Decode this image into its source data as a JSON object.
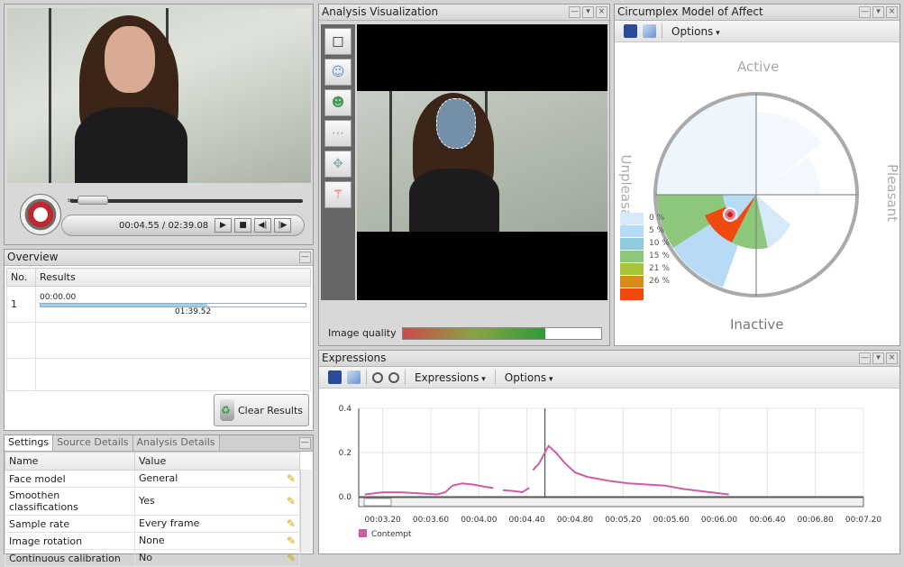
{
  "video": {
    "seek_equal": "=",
    "time_readout": "00:04.55 / 02:39.08",
    "progress_fraction": 0.03,
    "controls": [
      "▶",
      "■",
      "◀|",
      "|▶"
    ]
  },
  "overview": {
    "title": "Overview",
    "col_no": "No.",
    "col_results": "Results",
    "row_no": "1",
    "row_start": "00:00.00",
    "row_end": "01:39.52",
    "clear_label": "Clear Results"
  },
  "settings": {
    "tabs": [
      "Settings",
      "Source Details",
      "Analysis Details"
    ],
    "col_name": "Name",
    "col_value": "Value",
    "rows": [
      {
        "name": "Face model",
        "value": "General"
      },
      {
        "name": "Smoothen classifications",
        "value": "Yes"
      },
      {
        "name": "Sample rate",
        "value": "Every frame"
      },
      {
        "name": "Image rotation",
        "value": "None"
      },
      {
        "name": "Continuous calibration",
        "value": "No"
      }
    ]
  },
  "analysis": {
    "title": "Analysis Visualization",
    "quality_label": "Image quality",
    "quality_fraction": 0.72
  },
  "circumplex": {
    "title": "Circumplex Model of Affect",
    "options_label": "Options",
    "label_top": "Active",
    "label_bottom": "Inactive",
    "label_left": "Unpleasant",
    "label_right": "Pleasant",
    "legend": [
      {
        "label": "0 %",
        "color": "#d6e9f8"
      },
      {
        "label": "5 %",
        "color": "#b7daf5"
      },
      {
        "label": "10 %",
        "color": "#8fcadd"
      },
      {
        "label": "15 %",
        "color": "#8cc87c"
      },
      {
        "label": "21 %",
        "color": "#a7c33b"
      },
      {
        "label": "26 %",
        "color": "#d98a1a"
      },
      {
        "label": "",
        "color": "#f04a10"
      }
    ]
  },
  "expressions": {
    "title": "Expressions",
    "expressions_label": "Expressions",
    "options_label": "Options",
    "legend_label": "Contempt",
    "legend_color": "#d05ca8"
  },
  "chart_data": {
    "type": "line",
    "title": "",
    "xlabel": "",
    "ylabel": "",
    "ylim": [
      0,
      0.4
    ],
    "yticks": [
      0.0,
      0.2,
      0.4
    ],
    "xticks": [
      "00:03.20",
      "00:03.60",
      "00:04.00",
      "00:04.40",
      "00:04.80",
      "00:05.20",
      "00:05.60",
      "00:06.00",
      "00:06.40",
      "00:06.80",
      "00:07.20"
    ],
    "cursor_x": 4.55,
    "series": [
      {
        "name": "Contempt",
        "segments": [
          [
            [
              3.05,
              0.01
            ],
            [
              3.2,
              0.02
            ],
            [
              3.35,
              0.02
            ],
            [
              3.5,
              0.015
            ],
            [
              3.65,
              0.01
            ],
            [
              3.72,
              0.02
            ],
            [
              3.78,
              0.05
            ],
            [
              3.86,
              0.06
            ],
            [
              3.95,
              0.055
            ],
            [
              4.05,
              0.045
            ],
            [
              4.12,
              0.04
            ]
          ],
          [
            [
              4.2,
              0.03
            ],
            [
              4.3,
              0.025
            ],
            [
              4.36,
              0.02
            ],
            [
              4.42,
              0.04
            ]
          ],
          [
            [
              4.45,
              0.12
            ],
            [
              4.5,
              0.15
            ],
            [
              4.54,
              0.19
            ],
            [
              4.58,
              0.23
            ],
            [
              4.64,
              0.2
            ],
            [
              4.72,
              0.15
            ],
            [
              4.8,
              0.11
            ],
            [
              4.9,
              0.09
            ],
            [
              5.0,
              0.08
            ],
            [
              5.1,
              0.07
            ],
            [
              5.25,
              0.06
            ],
            [
              5.4,
              0.055
            ],
            [
              5.55,
              0.05
            ],
            [
              5.7,
              0.035
            ],
            [
              5.85,
              0.025
            ],
            [
              6.0,
              0.015
            ],
            [
              6.08,
              0.01
            ]
          ]
        ]
      }
    ]
  }
}
